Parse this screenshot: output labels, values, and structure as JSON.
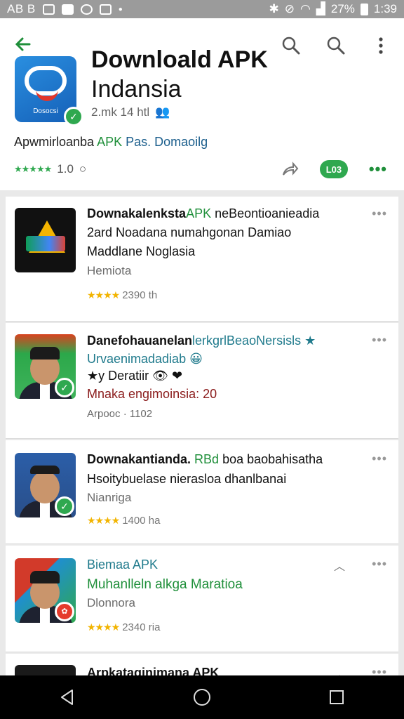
{
  "status_bar": {
    "carrier": "AB B",
    "battery": "27%",
    "time": "1:39"
  },
  "header": {
    "title_line1": "Downloald APK",
    "title_line2": "Indansia",
    "icon_caption": "Dosocsi",
    "meta": "2.mk 14 htl",
    "subtitle_a": "Apwmirloanba",
    "subtitle_b": "APK",
    "subtitle_c": "Pas. Domaoilg",
    "rating_value": "1.0",
    "badge_label": "L03",
    "stars": "★★★★★",
    "icons": {
      "back": "arrow-left-icon",
      "search1": "search-icon",
      "search2": "search-icon",
      "menu": "overflow-menu-icon",
      "share": "share-icon"
    }
  },
  "items": [
    {
      "title_a": "Downakalenksta",
      "title_b": "APK",
      "title_c": " neBeontioanieadia",
      "line2": "2ard Noadana numahgonan Damiao",
      "line3": "Maddlane Noglasia",
      "developer": "Hemiota",
      "stars": "★★★★",
      "rating_text": "2390 th",
      "thumb": "drive"
    },
    {
      "title_a": "Danefohauanelan",
      "title_b": "lerkgrlBeaoNersisls ★",
      "line2_a": "Urvaenimadadiab 😀",
      "line3_a": "★y Deratiir",
      "line3_b": " 👁 ❤",
      "line4": "Mnaka engimoinsia: 20",
      "developer": "Arpooc · 1102",
      "thumb": "person"
    },
    {
      "title_a": "Downakantianda.",
      "title_b": "RBd",
      "title_c": " boa baobahisatha",
      "line2": "Hsoitybuelase nierasloa dhanlbanai",
      "developer": "Nianriga",
      "stars": "★★★★",
      "rating_text": "1400 ha",
      "thumb": "blue"
    },
    {
      "title_a": "Biemaa APK",
      "line2": "Muhanlleln alkga Maratioa",
      "developer": "Dlonnora",
      "stars": "★★★★",
      "rating_text": "2340 ria",
      "thumb": "multi"
    },
    {
      "title_a": "Arpkataginimana APK"
    }
  ],
  "item_menu": "•••",
  "nav": {
    "back": "back-triangle-icon",
    "home": "home-circle-icon",
    "recents": "recents-square-icon"
  }
}
